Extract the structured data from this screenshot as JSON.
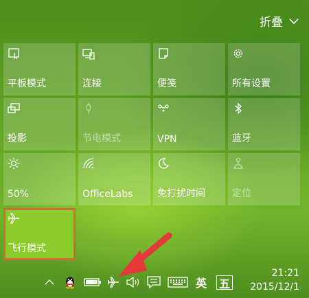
{
  "header": {
    "collapse_label": "折叠"
  },
  "tiles": [
    {
      "label": "平板模式",
      "icon": "tablet-mode-icon"
    },
    {
      "label": "连接",
      "icon": "connect-icon"
    },
    {
      "label": "便笺",
      "icon": "note-icon"
    },
    {
      "label": "所有设置",
      "icon": "gear-icon"
    },
    {
      "label": "投影",
      "icon": "project-icon"
    },
    {
      "label": "节电模式",
      "icon": "battery-saver-icon"
    },
    {
      "label": "VPN",
      "icon": "vpn-icon"
    },
    {
      "label": "蓝牙",
      "icon": "bluetooth-icon"
    },
    {
      "label": "50%",
      "icon": "brightness-icon"
    },
    {
      "label": "OfficeLabs",
      "icon": "wifi-icon"
    },
    {
      "label": "免打扰时间",
      "icon": "moon-icon"
    },
    {
      "label": "定位",
      "icon": "location-icon"
    },
    {
      "label": "飞行模式",
      "icon": "airplane-icon"
    }
  ],
  "taskbar": {
    "ime_lang": "英",
    "ime_mode": "五",
    "time": "21:21",
    "date": "2015/12/1"
  },
  "colors": {
    "active_tile": "#8bcc2c",
    "highlight_border": "#d36a3a",
    "arrow": "#e53b3b"
  }
}
